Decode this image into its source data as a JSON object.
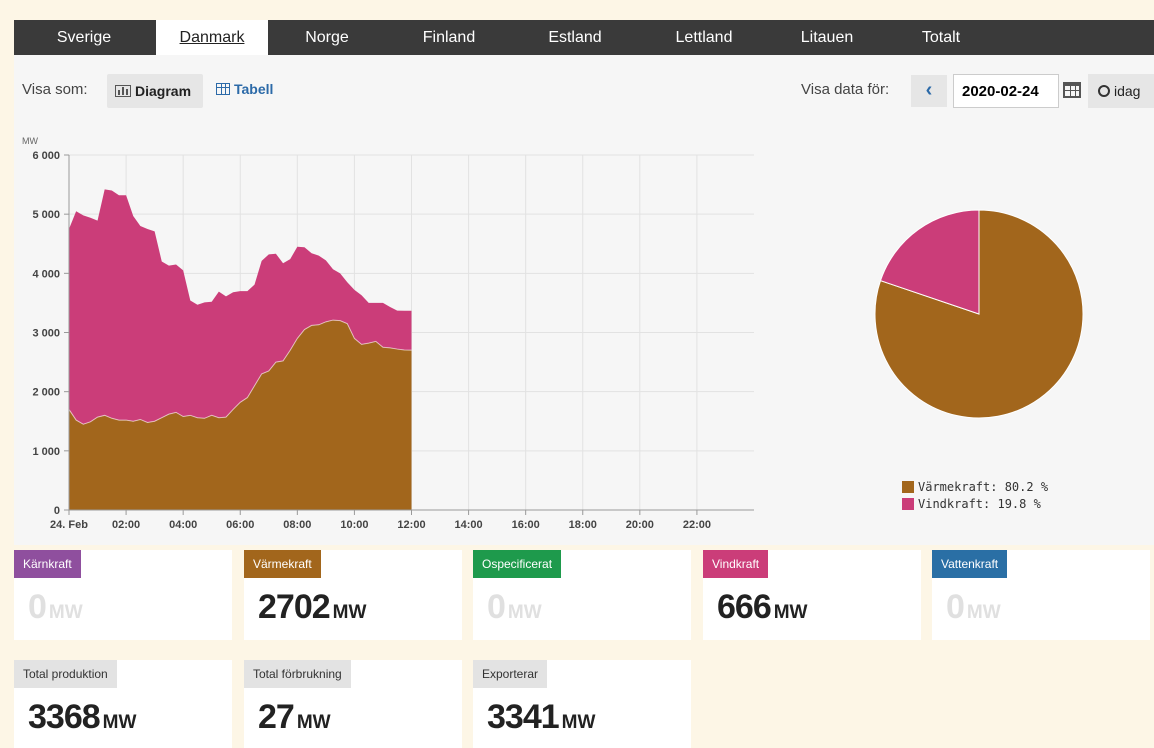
{
  "tabs": [
    {
      "label": "Sverige",
      "active": false
    },
    {
      "label": "Danmark",
      "active": true
    },
    {
      "label": "Norge",
      "active": false
    },
    {
      "label": "Finland",
      "active": false
    },
    {
      "label": "Estland",
      "active": false
    },
    {
      "label": "Lettland",
      "active": false
    },
    {
      "label": "Litauen",
      "active": false
    },
    {
      "label": "Totalt",
      "active": false
    }
  ],
  "toolbar": {
    "visa_som_label": "Visa som:",
    "diagram_label": "Diagram",
    "tabell_label": "Tabell",
    "visa_data_label": "Visa data för:",
    "date_value": "2020-02-24",
    "idag_label": "idag"
  },
  "colors": {
    "varmekraft": "#a2661c",
    "vindkraft": "#cb3d79",
    "karnkraft": "#8f4f9e",
    "ospecificerat": "#1e9a4c",
    "vattenkraft": "#2a6fa5"
  },
  "chart_data": [
    {
      "type": "area",
      "stacked": true,
      "ylabel": "MW",
      "ylim": [
        0,
        6000
      ],
      "yticks": [
        "6 000",
        "5 000",
        "4 000",
        "3 000",
        "2 000",
        "1 000",
        "0"
      ],
      "yticks_values": [
        6000,
        5000,
        4000,
        3000,
        2000,
        1000,
        0
      ],
      "xticks": [
        "24. Feb",
        "02:00",
        "04:00",
        "06:00",
        "08:00",
        "10:00",
        "12:00",
        "14:00",
        "16:00",
        "18:00",
        "20:00",
        "22:00"
      ],
      "xlim": [
        0,
        24
      ],
      "grid": true,
      "x": [
        0,
        0.25,
        0.5,
        0.75,
        1,
        1.25,
        1.5,
        1.75,
        2,
        2.25,
        2.5,
        2.75,
        3,
        3.25,
        3.5,
        3.75,
        4,
        4.25,
        4.5,
        4.75,
        5,
        5.25,
        5.5,
        5.75,
        6,
        6.25,
        6.5,
        6.75,
        7,
        7.25,
        7.5,
        7.75,
        8,
        8.25,
        8.5,
        8.75,
        9,
        9.25,
        9.5,
        9.75,
        10,
        10.25,
        10.5,
        10.75,
        11,
        11.25,
        11.5,
        11.75,
        12
      ],
      "series": [
        {
          "name": "Värmekraft",
          "color": "#a2661c",
          "values": [
            1700,
            1520,
            1450,
            1490,
            1570,
            1600,
            1550,
            1520,
            1520,
            1500,
            1530,
            1480,
            1500,
            1560,
            1620,
            1650,
            1580,
            1600,
            1560,
            1550,
            1600,
            1560,
            1570,
            1700,
            1820,
            1900,
            2100,
            2300,
            2350,
            2500,
            2520,
            2700,
            2900,
            3050,
            3120,
            3130,
            3180,
            3210,
            3200,
            3150,
            2900,
            2800,
            2820,
            2850,
            2750,
            2740,
            2720,
            2705,
            2702
          ]
        },
        {
          "name": "Vindkraft",
          "color": "#cb3d79",
          "values": [
            3050,
            3530,
            3530,
            3450,
            3320,
            3820,
            3850,
            3800,
            3800,
            3470,
            3270,
            3270,
            3210,
            2640,
            2510,
            2500,
            2470,
            1940,
            1910,
            1960,
            1920,
            2130,
            2040,
            1980,
            1880,
            1800,
            1710,
            1910,
            1970,
            1830,
            1650,
            1540,
            1550,
            1390,
            1220,
            1170,
            1040,
            860,
            800,
            700,
            820,
            830,
            680,
            650,
            750,
            690,
            650,
            662,
            666
          ]
        }
      ]
    },
    {
      "type": "pie",
      "slices": [
        {
          "label": "Värmekraft",
          "value": 80.2,
          "color": "#a2661c"
        },
        {
          "label": "Vindkraft",
          "value": 19.8,
          "color": "#cb3d79"
        }
      ],
      "legend": [
        "Värmekraft: 80.2 %",
        "Vindkraft: 19.8 %"
      ],
      "legend_position": "bottom"
    }
  ],
  "cards": {
    "karnkraft": {
      "label": "Kärnkraft",
      "value": "0",
      "unit": "MW"
    },
    "varmekraft": {
      "label": "Värmekraft",
      "value": "2702",
      "unit": "MW"
    },
    "ospecificerat": {
      "label": "Ospecificerat",
      "value": "0",
      "unit": "MW"
    },
    "vindkraft": {
      "label": "Vindkraft",
      "value": "666",
      "unit": "MW"
    },
    "vattenkraft": {
      "label": "Vattenkraft",
      "value": "0",
      "unit": "MW"
    },
    "total_produktion": {
      "label": "Total produktion",
      "value": "3368",
      "unit": "MW"
    },
    "total_forbrukning": {
      "label": "Total förbrukning",
      "value": "27",
      "unit": "MW"
    },
    "exporterar": {
      "label": "Exporterar",
      "value": "3341",
      "unit": "MW"
    }
  }
}
